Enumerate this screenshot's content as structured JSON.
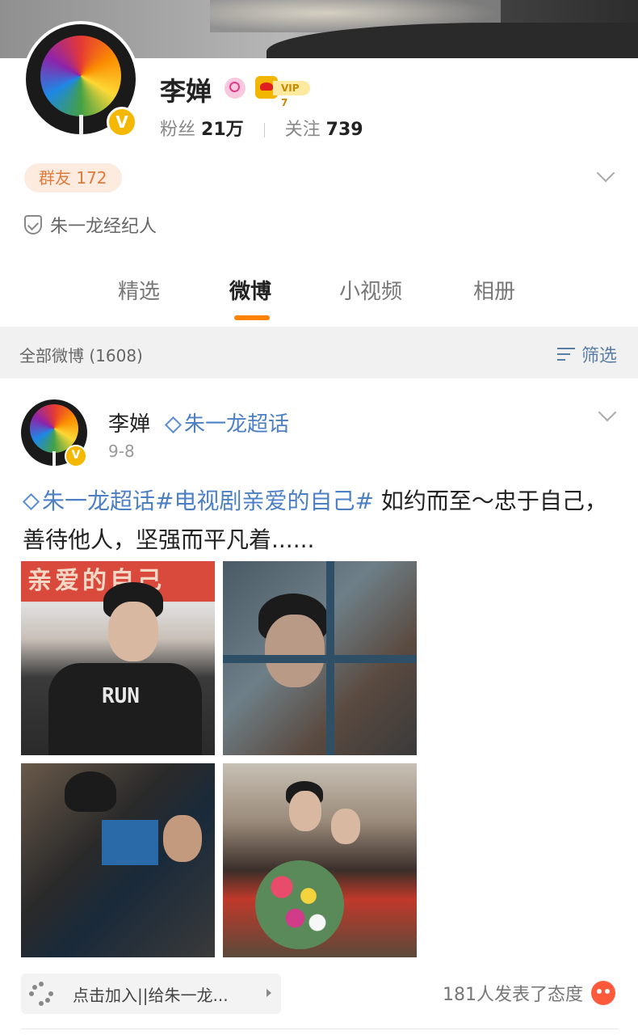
{
  "profile": {
    "name": "李婵",
    "vip_label": "VIP 7",
    "fans_label": "粉丝",
    "fans_value": "21万",
    "following_label": "关注",
    "following_value": "739",
    "group_friend": "群友 172",
    "certification": "朱一龙经纪人",
    "verified_mark": "V"
  },
  "tabs": [
    {
      "label": "精选"
    },
    {
      "label": "微博"
    },
    {
      "label": "小视频"
    },
    {
      "label": "相册"
    }
  ],
  "filter_bar": {
    "count_label": "全部微博 (1608)",
    "filter_label": "筛选"
  },
  "post": {
    "author": "李婵",
    "super_topic": "朱一龙超话",
    "date": "9-8",
    "topic_1": "朱一龙超话",
    "topic_2": "#电视剧亲爱的自己#",
    "text_rest": " 如约而至～忠于自己，善待他人，坚强而平凡着......",
    "photo_1_banner": "亲爱的自己",
    "photo_1_shirt": "RUN",
    "join_chip": "点击加入||给朱一龙...",
    "reactions": "181人发表了态度"
  },
  "colors": {
    "accent_orange": "#ff8200",
    "link_blue": "#4c7fc4",
    "vip_gold": "#f2b500"
  },
  "icons": [
    "search-badge-icon",
    "vip-crown-icon",
    "chevron-down-icon",
    "shield-check-icon",
    "filter-icon",
    "diamond-icon",
    "sparkle-icon",
    "angry-emoji-icon"
  ]
}
